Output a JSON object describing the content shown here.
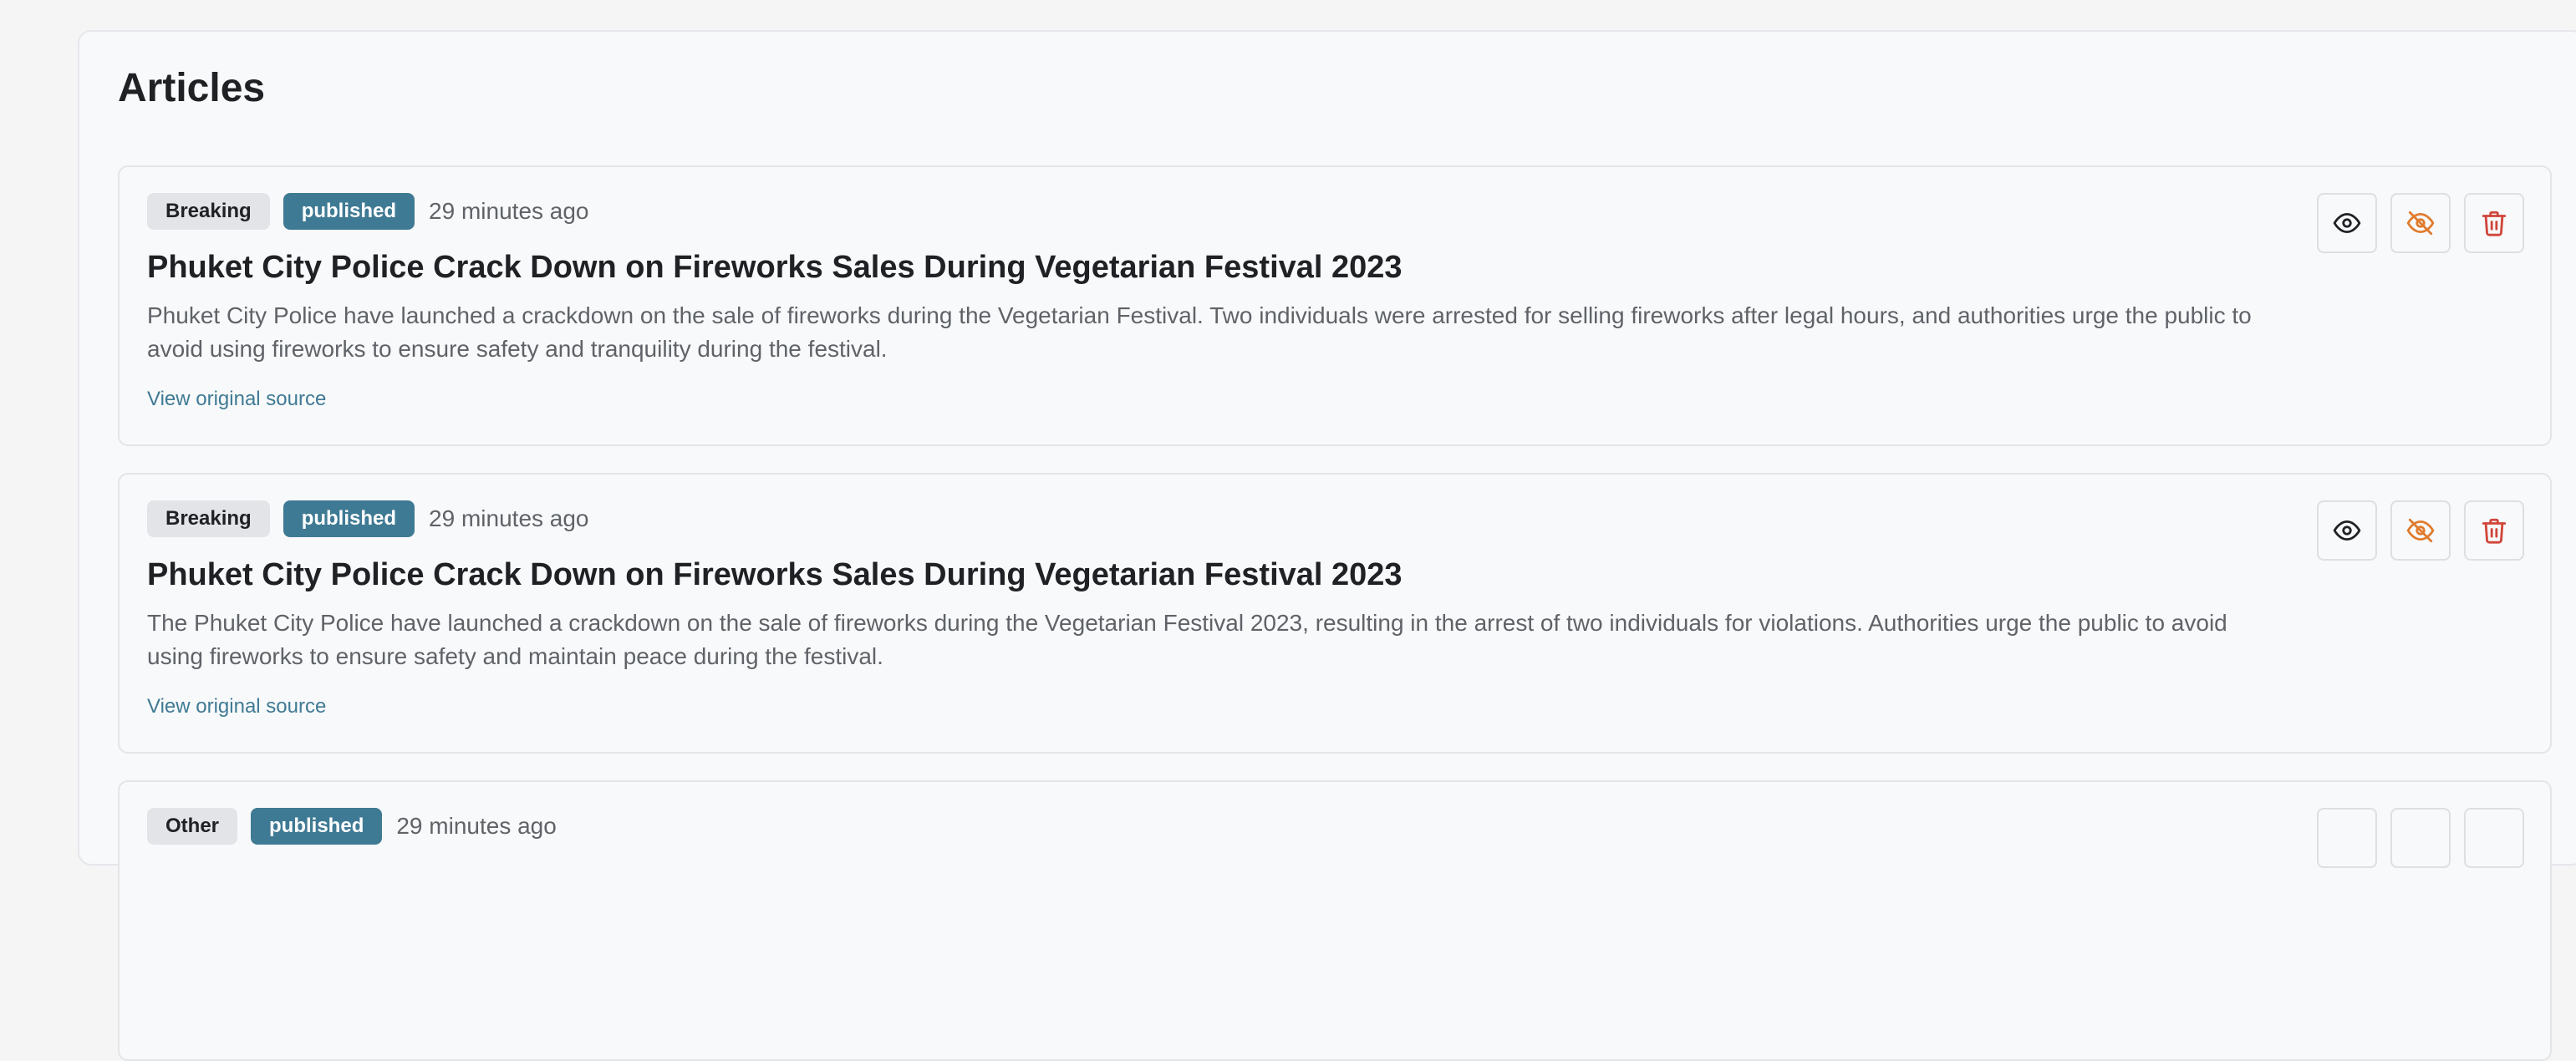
{
  "page": {
    "title": "Articles"
  },
  "colors": {
    "accent": "#3f7a94",
    "hide": "#e07b2e",
    "delete": "#d0453a"
  },
  "icons": {
    "view": "eye-icon",
    "hide": "eye-off-icon",
    "delete": "trash-icon"
  },
  "articles": [
    {
      "category": "Breaking",
      "status": "published",
      "time": "29 minutes ago",
      "title": "Phuket City Police Crack Down on Fireworks Sales During Vegetarian Festival 2023",
      "summary": "Phuket City Police have launched a crackdown on the sale of fireworks during the Vegetarian Festival. Two individuals were arrested for selling fireworks after legal hours, and authorities urge the public to avoid using fireworks to ensure safety and tranquility during the festival.",
      "source_label": "View original source"
    },
    {
      "category": "Breaking",
      "status": "published",
      "time": "29 minutes ago",
      "title": "Phuket City Police Crack Down on Fireworks Sales During Vegetarian Festival 2023",
      "summary": "The Phuket City Police have launched a crackdown on the sale of fireworks during the Vegetarian Festival 2023, resulting in the arrest of two individuals for violations. Authorities urge the public to avoid using fireworks to ensure safety and maintain peace during the festival.",
      "source_label": "View original source"
    },
    {
      "category": "Other",
      "status": "published",
      "time": "29 minutes ago"
    }
  ]
}
